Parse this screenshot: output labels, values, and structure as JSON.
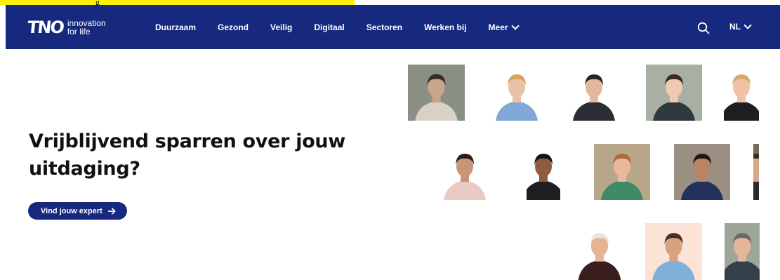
{
  "banner": {
    "text": "g"
  },
  "header": {
    "logo": {
      "mark": "TNO",
      "tagline": "innovation for life"
    },
    "nav": [
      {
        "label": "Duurzaam"
      },
      {
        "label": "Gezond"
      },
      {
        "label": "Veilig"
      },
      {
        "label": "Digitaal"
      },
      {
        "label": "Sectoren"
      },
      {
        "label": "Werken bij"
      },
      {
        "label": "Meer",
        "has_dropdown": true
      }
    ],
    "search_icon": "search-icon",
    "language": "NL"
  },
  "hero": {
    "title": "Vrijblijvend sparren over jouw uitdaging?",
    "cta_label": "Vind jouw expert",
    "cta_icon": "arrow-right-icon"
  },
  "experts": [
    {
      "name": "expert-photo-1",
      "bg": "#8a8f86",
      "skin": "#c9a38a",
      "hair": "#3b2a22",
      "shirt": "#d8d2c6"
    },
    {
      "name": "expert-photo-2",
      "bg": "#ffffff",
      "skin": "#e8c1a6",
      "hair": "#d9a35c",
      "shirt": "#7fa8d6"
    },
    {
      "name": "expert-photo-3",
      "bg": "#ffffff",
      "skin": "#e2b89c",
      "hair": "#2a2420",
      "shirt": "#2c2c34"
    },
    {
      "name": "expert-photo-4",
      "bg": "#a7b0a3",
      "skin": "#efc9b2",
      "hair": "#3a2b22",
      "shirt": "#2e3a3e"
    },
    {
      "name": "expert-photo-5",
      "bg": "#ffffff",
      "skin": "#efc2a6",
      "hair": "#d6aa6e",
      "shirt": "#1e1e22"
    },
    {
      "name": "expert-photo-6",
      "bg": "#ffffff",
      "skin": "#c99576",
      "hair": "#2b1c16",
      "shirt": "#eac9c4"
    },
    {
      "name": "expert-photo-7",
      "bg": "#ffffff",
      "skin": "#8e5b40",
      "hair": "#161210",
      "shirt": "#1e1e22"
    },
    {
      "name": "expert-photo-8",
      "bg": "#b8a68a",
      "skin": "#eab79a",
      "hair": "#b06a3a",
      "shirt": "#3f8a68"
    },
    {
      "name": "expert-photo-9",
      "bg": "#9a8f80",
      "skin": "#b88464",
      "hair": "#231712",
      "shirt": "#24305e"
    },
    {
      "name": "expert-photo-10",
      "bg": "#7a6a58",
      "skin": "#d9a888",
      "hair": "#3b2a22",
      "shirt": "#2a2a2a"
    },
    {
      "name": "expert-photo-11",
      "bg": "#ffffff",
      "skin": "#e6b393",
      "hair": "#e8e6e0",
      "shirt": "#3a1e1e"
    },
    {
      "name": "expert-photo-12",
      "bg": "#fbe4d7",
      "skin": "#d9a27e",
      "hair": "#4a2c20",
      "shirt": "#7fb0d8"
    },
    {
      "name": "expert-photo-13",
      "bg": "#9ea59a",
      "skin": "#e4b79c",
      "hair": "#6b6a66",
      "shirt": "#33404a"
    }
  ]
}
